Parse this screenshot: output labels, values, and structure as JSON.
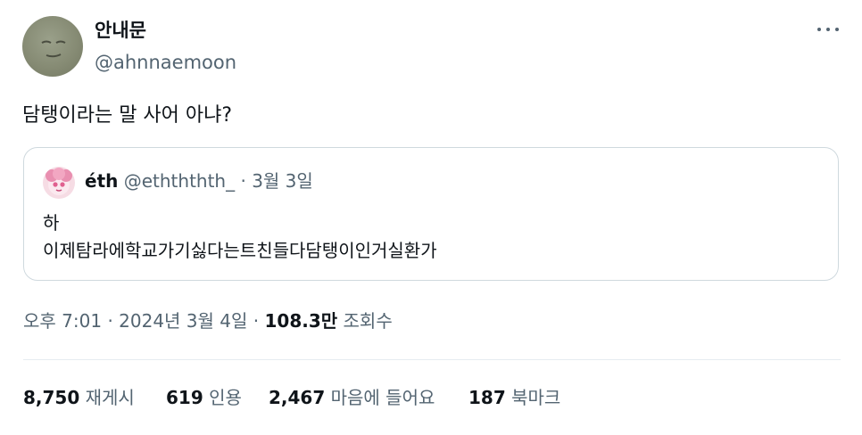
{
  "author": {
    "display_name": "안내문",
    "handle": "@ahnnaemoon"
  },
  "tweet": {
    "text": "담탱이라는 말 사어 아냐?"
  },
  "quote": {
    "display_name": "éth",
    "handle": "@ethththth_",
    "separator": "·",
    "date": "3월 3일",
    "line1": "하",
    "line2": "이제탐라에학교가기싫다는트친들다담탱이인거실환가"
  },
  "meta": {
    "time": "오후 7:01",
    "sep1": "·",
    "date": "2024년 3월 4일",
    "sep2": "·",
    "views_count": "108.3만",
    "views_label": "조회수"
  },
  "stats": {
    "reposts_count": "8,750",
    "reposts_label": "재게시",
    "quotes_count": "619",
    "quotes_label": "인용",
    "likes_count": "2,467",
    "likes_label": "마음에 들어요",
    "bookmarks_count": "187",
    "bookmarks_label": "북마크"
  },
  "icons": {
    "more": "more-horizontal-icon"
  }
}
